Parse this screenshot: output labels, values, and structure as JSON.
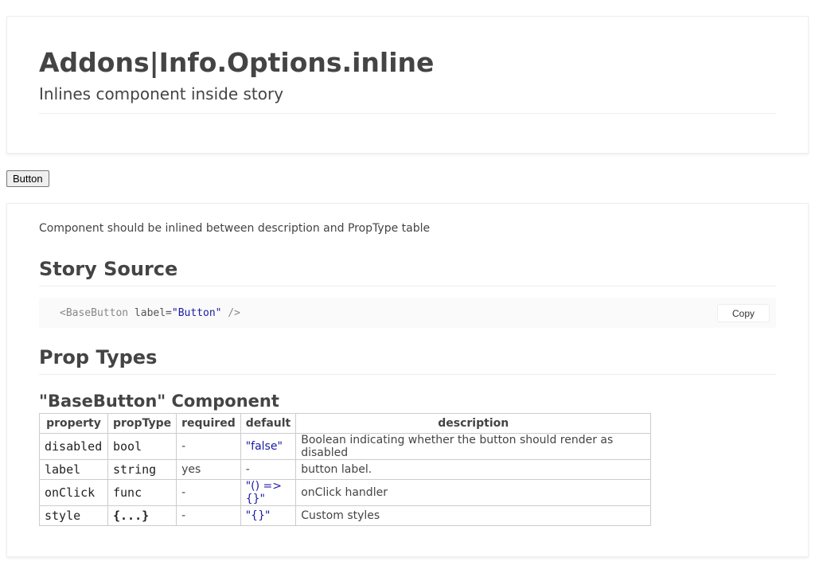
{
  "header": {
    "title": "Addons|Info.Options.inline",
    "subtitle": "Inlines component inside story"
  },
  "preview": {
    "button_label": "Button"
  },
  "info": {
    "description": "Component should be inlined between description and PropType table",
    "story_source_heading": "Story Source",
    "code": {
      "tag_open": "<BaseButton",
      "attr": "label=",
      "value": "\"Button\"",
      "tag_close": "/>"
    },
    "copy_label": "Copy",
    "prop_types_heading": "Prop Types",
    "component_heading": "\"BaseButton\" Component",
    "table": {
      "headers": [
        "property",
        "propType",
        "required",
        "default",
        "description"
      ],
      "rows": [
        {
          "property": "disabled",
          "propType": "bool",
          "required": "-",
          "default": "\"false\"",
          "description": "Boolean indicating whether the button should render as disabled"
        },
        {
          "property": "label",
          "propType": "string",
          "required": "yes",
          "default": "-",
          "description": "button label."
        },
        {
          "property": "onClick",
          "propType": "func",
          "required": "-",
          "default": "\"() => {}\"",
          "description": "onClick handler"
        },
        {
          "property": "style",
          "propType": "{...}",
          "required": "-",
          "default": "\"{}\"",
          "description": "Custom styles"
        }
      ]
    }
  }
}
